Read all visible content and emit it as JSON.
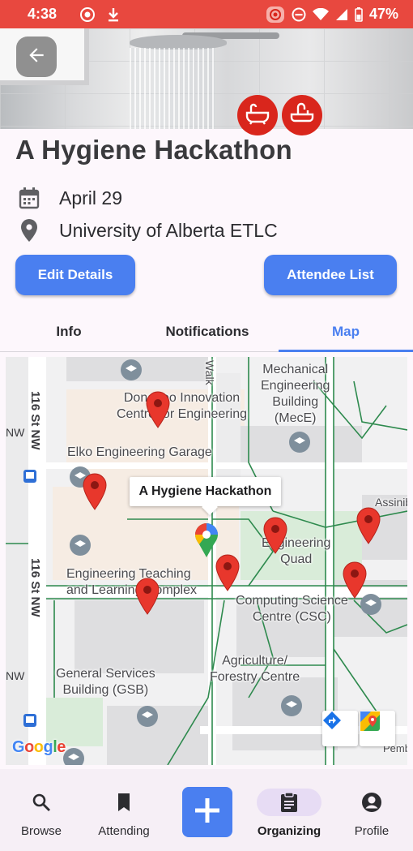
{
  "status_bar": {
    "time": "4:38",
    "battery": "47%"
  },
  "event": {
    "title": "A Hygiene Hackathon",
    "date": "April 29",
    "location": "University of Alberta ETLC",
    "category_icons": [
      "bathtub-icon",
      "sink-icon"
    ]
  },
  "actions": {
    "edit_label": "Edit Details",
    "attendee_label": "Attendee List"
  },
  "tabs": [
    {
      "label": "Info",
      "active": false
    },
    {
      "label": "Notifications",
      "active": false
    },
    {
      "label": "Map",
      "active": true
    }
  ],
  "map": {
    "callout": "A Hygiene Hackathon",
    "labels": {
      "mecE": "Mechanical\nEngineering\nBuilding\n(MecE)",
      "donadeo": "Donadeo Innovation\nCentre for Engineering",
      "elko": "Elko Engineering Garage",
      "assini": "Assinib",
      "eng_quad": "Engineering\nQuad",
      "etlc": "Engineering Teaching\nand Learning Complex",
      "csc": "Computing Science\nCentre (CSC)",
      "agri": "Agriculture/\nForestry Centre",
      "gsb": "General Services\nBuilding (GSB)",
      "street_1": "116 St NW",
      "street_2": "116 St NW",
      "nw_1": "NW",
      "nw_2": "NW",
      "walk": "Walk",
      "pemb": "Pemb",
      "google": "Google"
    }
  },
  "bottom_nav": [
    {
      "label": "Browse",
      "icon": "search-icon",
      "active": false
    },
    {
      "label": "Attending",
      "icon": "bookmark-icon",
      "active": false
    },
    {
      "label": "Organizing",
      "icon": "clipboard-icon",
      "active": true
    },
    {
      "label": "Profile",
      "icon": "account-icon",
      "active": false
    }
  ],
  "colors": {
    "accent": "#4a7ff0",
    "status_bar": "#e8483f",
    "badge_red": "#d9261c",
    "pin_red": "#e8372c"
  }
}
